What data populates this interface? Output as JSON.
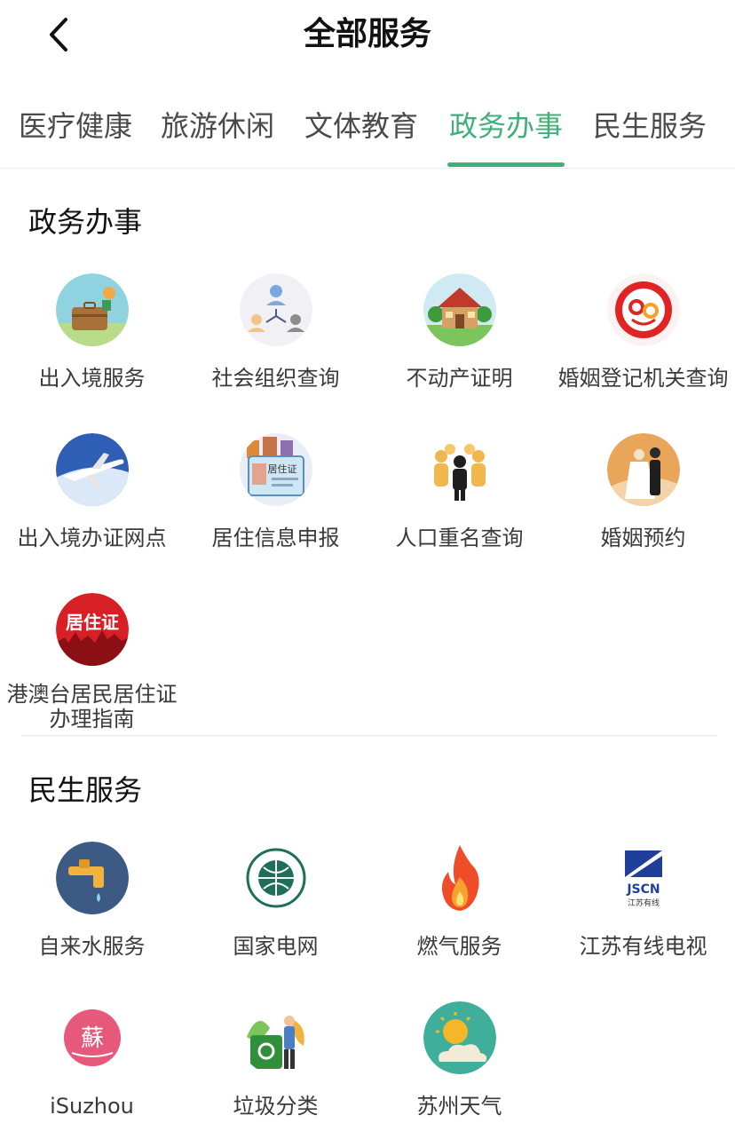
{
  "header": {
    "title": "全部服务"
  },
  "tabs": [
    "医疗健康",
    "旅游休闲",
    "文体教育",
    "政务办事",
    "民生服务"
  ],
  "active_tab": "政务办事",
  "accent_color": "#3fb07a",
  "sections": [
    {
      "title": "政务办事",
      "items": [
        {
          "label": "出入境服务",
          "icon": "travel-suitcase-icon"
        },
        {
          "label": "社会组织查询",
          "icon": "organization-network-icon"
        },
        {
          "label": "不动产证明",
          "icon": "house-icon"
        },
        {
          "label": "婚姻登记机关查询",
          "icon": "marriage-registry-logo-icon"
        },
        {
          "label": "出入境办证网点",
          "icon": "airplane-icon"
        },
        {
          "label": "居住信息申报",
          "icon": "residence-card-icon"
        },
        {
          "label": "人口重名查询",
          "icon": "people-group-icon"
        },
        {
          "label": "婚姻预约",
          "icon": "wedding-couple-icon"
        },
        {
          "label": "港澳台居民居住证办理指南",
          "icon": "residence-permit-city-icon"
        }
      ]
    },
    {
      "title": "民生服务",
      "items": [
        {
          "label": "自来水服务",
          "icon": "water-tap-icon"
        },
        {
          "label": "国家电网",
          "icon": "state-grid-logo-icon"
        },
        {
          "label": "燃气服务",
          "icon": "gas-flame-icon"
        },
        {
          "label": "江苏有线电视",
          "icon": "jscn-logo-icon"
        },
        {
          "label": "iSuzhou",
          "icon": "isuzhou-logo-icon"
        },
        {
          "label": "垃圾分类",
          "icon": "garbage-sorting-icon"
        },
        {
          "label": "苏州天气",
          "icon": "weather-sun-cloud-icon"
        }
      ]
    }
  ],
  "logos": {
    "jscn_text": "JSCN",
    "jscn_sub": "江苏有线",
    "isuzhou_char": "蘇",
    "residence_text": "居住证",
    "card_text": "居住证"
  }
}
